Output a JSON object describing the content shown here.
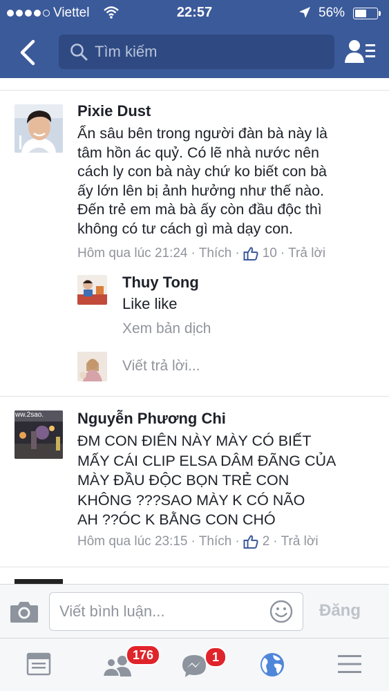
{
  "status_bar": {
    "carrier": "Viettel",
    "time": "22:57",
    "battery_percent": "56%",
    "battery_level": 0.56,
    "signal_bars": 4
  },
  "header": {
    "search_placeholder": "Tìm kiếm",
    "icons": [
      "back-arrow-icon",
      "search-icon",
      "friends-list-icon"
    ]
  },
  "comments": [
    {
      "author": "Pixie Dust",
      "lines": [
        "Ẩn sâu bên trong người đàn bà này là",
        "tâm hồn ác quỷ. Có lẽ nhà nước nên",
        "cách ly con bà này chứ ko biết con bà",
        "ấy lớn lên bị ảnh hưởng như thế nào.",
        "Đến trẻ em mà bà ấy còn đầu độc thì",
        "không có tư cách gì mà dạy con."
      ],
      "timestamp": "Hôm qua lúc 21:24",
      "like_label": "Thích",
      "like_count": "10",
      "reply_label": "Trả lời",
      "replies": [
        {
          "author": "Thuy Tong",
          "text": "Like like",
          "translate_label": "Xem bản dịch"
        }
      ],
      "reply_placeholder": "Viết trả lời..."
    },
    {
      "author": "Nguyễn Phương Chi",
      "avatar_caption": "ww.2sao.",
      "lines": [
        "ĐM CON ĐIÊN NÀY MÀY CÓ BIẾT",
        "MẤY CÁI CLIP ELSA DÂM ĐÃNG CỦA",
        "MÀY ĐẦU ĐỘC BỌN TRẺ CON",
        "KHÔNG ???SAO MÀY K CÓ NÃO",
        "AH ??ÓC K BẰNG CON CHÓ"
      ],
      "timestamp": "Hôm qua lúc 23:15",
      "like_label": "Thích",
      "like_count": "2",
      "reply_label": "Trả lời"
    }
  ],
  "composer": {
    "placeholder": "Viết bình luận...",
    "post_label": "Đăng"
  },
  "tabbar": {
    "tabs": [
      {
        "icon": "news-feed-icon"
      },
      {
        "icon": "friend-requests-icon",
        "badge": "176"
      },
      {
        "icon": "messenger-icon",
        "badge": "1"
      },
      {
        "icon": "notifications-globe-icon"
      },
      {
        "icon": "menu-icon"
      }
    ]
  },
  "colors": {
    "brand_blue": "#3b5a9a",
    "badge_red": "#e0242b",
    "meta_gray": "#90949c"
  }
}
